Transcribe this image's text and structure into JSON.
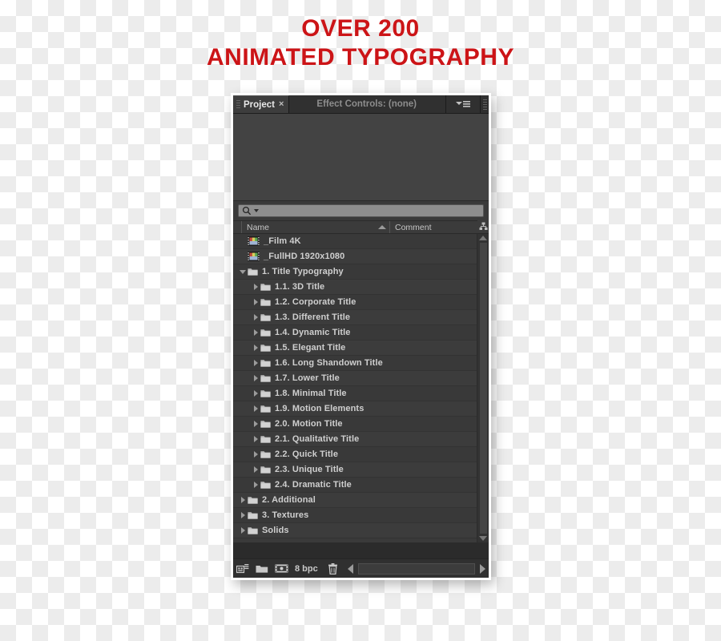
{
  "headline": {
    "line1": "OVER 200",
    "line2": "ANIMATED TYPOGRAPHY",
    "color": "#cc1417"
  },
  "panel": {
    "tabs": [
      {
        "label": "Project",
        "active": true,
        "close": "×"
      },
      {
        "label": "Effect Controls: (none)",
        "active": false
      }
    ],
    "panel_menu_icon": "panel-menu-icon",
    "search": {
      "value": "",
      "placeholder": "",
      "icon": "search-icon"
    },
    "columns": {
      "name": "Name",
      "comment": "Comment",
      "sort_direction": "ascending"
    },
    "items": [
      {
        "label": "_Film 4K",
        "type": "composition",
        "indent": 0,
        "twirl": "none"
      },
      {
        "label": "_FullHD 1920x1080",
        "type": "composition",
        "indent": 0,
        "twirl": "none"
      },
      {
        "label": "1. Title Typography",
        "type": "folder",
        "indent": 0,
        "twirl": "down"
      },
      {
        "label": "1.1. 3D Title",
        "type": "folder",
        "indent": 1,
        "twirl": "right"
      },
      {
        "label": "1.2. Corporate Title",
        "type": "folder",
        "indent": 1,
        "twirl": "right"
      },
      {
        "label": "1.3. Different Title",
        "type": "folder",
        "indent": 1,
        "twirl": "right"
      },
      {
        "label": "1.4. Dynamic Title",
        "type": "folder",
        "indent": 1,
        "twirl": "right"
      },
      {
        "label": "1.5. Elegant Title",
        "type": "folder",
        "indent": 1,
        "twirl": "right"
      },
      {
        "label": "1.6. Long Shandown Title",
        "type": "folder",
        "indent": 1,
        "twirl": "right"
      },
      {
        "label": "1.7. Lower Title",
        "type": "folder",
        "indent": 1,
        "twirl": "right"
      },
      {
        "label": "1.8. Minimal Title",
        "type": "folder",
        "indent": 1,
        "twirl": "right"
      },
      {
        "label": "1.9. Motion Elements",
        "type": "folder",
        "indent": 1,
        "twirl": "right"
      },
      {
        "label": "2.0.  Motion Title",
        "type": "folder",
        "indent": 1,
        "twirl": "right"
      },
      {
        "label": "2.1. Qualitative Title",
        "type": "folder",
        "indent": 1,
        "twirl": "right"
      },
      {
        "label": "2.2. Quick Title",
        "type": "folder",
        "indent": 1,
        "twirl": "right"
      },
      {
        "label": "2.3. Unique Title",
        "type": "folder",
        "indent": 1,
        "twirl": "right"
      },
      {
        "label": "2.4. Dramatic Title",
        "type": "folder",
        "indent": 1,
        "twirl": "right"
      },
      {
        "label": "2. Additional",
        "type": "folder",
        "indent": 0,
        "twirl": "right"
      },
      {
        "label": "3. Textures",
        "type": "folder",
        "indent": 0,
        "twirl": "right"
      },
      {
        "label": "Solids",
        "type": "folder",
        "indent": 0,
        "twirl": "right"
      }
    ],
    "footer": {
      "project_settings_icon": "project-settings-icon",
      "new_folder_icon": "new-folder-icon",
      "new_composition_icon": "new-composition-icon",
      "bit_depth": "8 bpc",
      "delete_icon": "trash-icon"
    }
  }
}
